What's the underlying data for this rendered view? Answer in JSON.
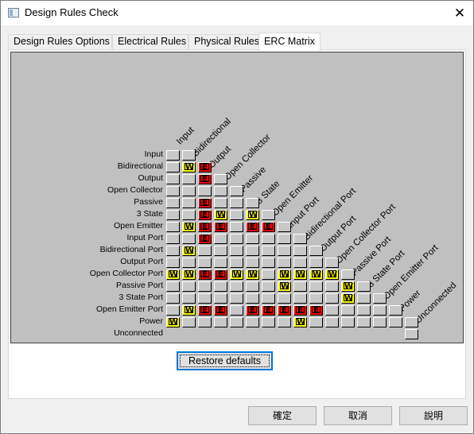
{
  "window": {
    "title": "Design Rules Check",
    "close_glyph": "✕",
    "icon": "dialog-icon"
  },
  "tabs": [
    {
      "label": "Design Rules Options",
      "active": false
    },
    {
      "label": "Electrical Rules",
      "active": false
    },
    {
      "label": "Physical Rules",
      "active": false
    },
    {
      "label": "ERC Matrix",
      "active": true
    }
  ],
  "matrix": {
    "pins": [
      "Input",
      "Bidirectional",
      "Output",
      "Open Collector",
      "Passive",
      "3 State",
      "Open Emitter",
      "Input Port",
      "Bidirectional Port",
      "Output Port",
      "Open Collector Port",
      "Passive Port",
      "3 State Port",
      "Open Emitter Port",
      "Power",
      "Unconnected"
    ],
    "rows": [
      "",
      "..",
      ".WE",
      "..E.",
      ".....",
      "..E...",
      "..EW.W.",
      ".WEE.EE.",
      "..E......",
      ".W........",
      "...........",
      "WWEEWW.WWWW.",
      ".......W...W.",
      "...........W..",
      ".WEE.EEEEE.....",
      "W.......W.......",
      ""
    ],
    "colors": {
      "warning": "#ffff00",
      "error": "#ee0000",
      "ok": "#c8c8c8",
      "background": "#c0c0c0"
    }
  },
  "buttons": {
    "restore": "Restore defaults",
    "ok": "確定",
    "cancel": "取消",
    "help": "說明"
  }
}
